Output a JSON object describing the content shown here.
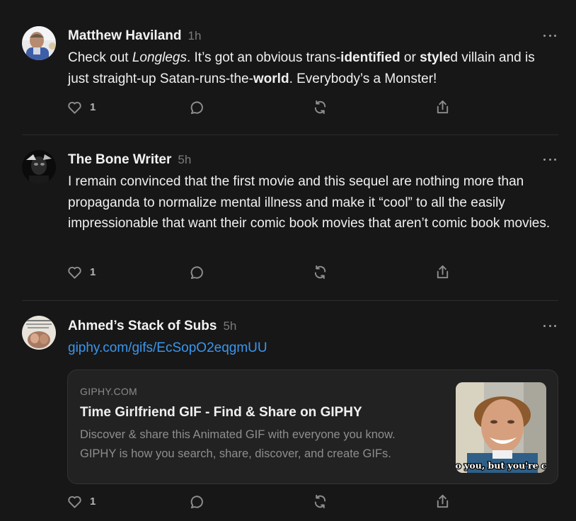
{
  "posts": [
    {
      "author": "Matthew Haviland",
      "time": "1h",
      "text_parts": [
        "Check out ",
        "Longlegs",
        ". It’s got an obvious trans-",
        "identified",
        " or ",
        "style",
        "d villain and is just straight-up Satan-runs-the-",
        "world",
        ". Everybody’s a Monster!"
      ],
      "likes": "1"
    },
    {
      "author": "The Bone Writer",
      "time": "5h",
      "text": "I remain convinced that the first movie and this sequel are nothing more than propaganda to normalize mental illness and make it “cool” to all the easily impressionable that want their comic book movies that aren’t comic book movies.",
      "likes": "1"
    },
    {
      "author": "Ahmed’s Stack of Subs",
      "time": "5h",
      "link": "giphy.com/gifs/EcSopO2eqgmUU",
      "card": {
        "site": "GIPHY.COM",
        "title": "Time Girlfriend GIF - Find & Share on GIPHY",
        "description": "Discover & share this Animated GIF with everyone you know. GIPHY is how you search, share, discover, and create GIFs.",
        "thumb_caption": "o you, but you're c"
      },
      "likes": "1"
    }
  ],
  "icons": {
    "like": "heart-icon",
    "comment": "comment-icon",
    "restack": "restack-icon",
    "share": "share-icon",
    "more": "more-icon"
  }
}
